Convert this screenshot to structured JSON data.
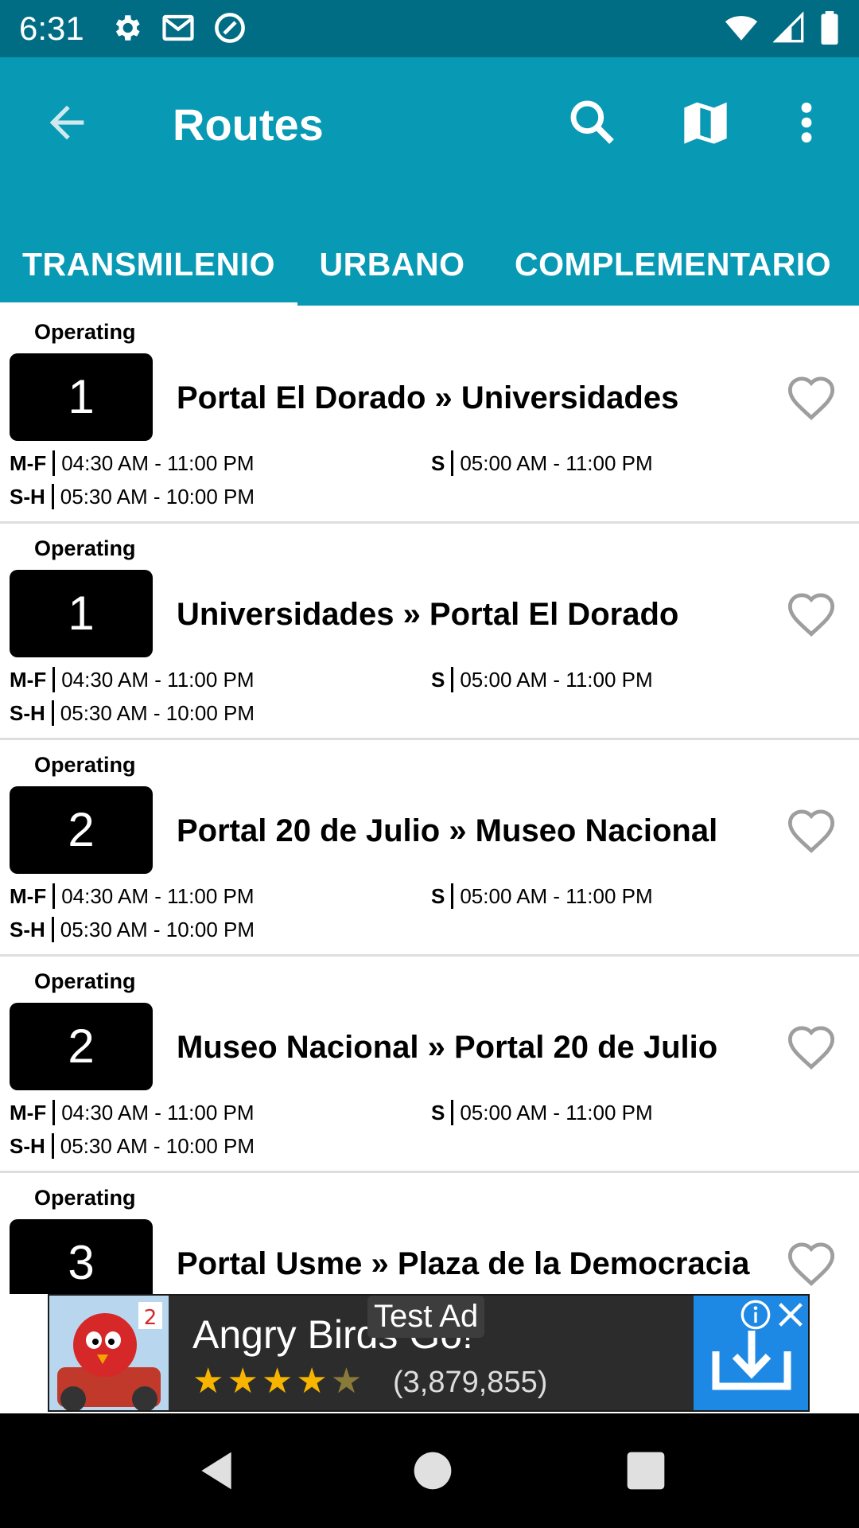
{
  "status_bar": {
    "time": "6:31",
    "icons": [
      "gear-icon",
      "gmail-icon",
      "at-sign-icon",
      "wifi-icon",
      "signal-icon",
      "battery-icon"
    ]
  },
  "app_bar": {
    "title": "Routes",
    "icons": [
      "back-arrow-icon",
      "search-icon",
      "map-icon",
      "more-vert-icon"
    ]
  },
  "tabs": [
    {
      "label": "TRANSMILENIO",
      "selected": true
    },
    {
      "label": "URBANO",
      "selected": false
    },
    {
      "label": "COMPLEMENTARIO",
      "selected": false
    }
  ],
  "colors": {
    "app_bar": "#0899b4",
    "status_bar": "#006d84",
    "tab_indicator": "#ffffff"
  },
  "routes": [
    {
      "status": "Operating",
      "number": "1",
      "name": "Portal El Dorado » Universidades",
      "mf_day": "M-F",
      "mf_hours": "04:30 AM - 11:00 PM",
      "s_day": "S",
      "s_hours": "05:00 AM - 11:00 PM",
      "sh_day": "S-H",
      "sh_hours": "05:30 AM - 10:00 PM"
    },
    {
      "status": "Operating",
      "number": "1",
      "name": "Universidades » Portal El Dorado",
      "mf_day": "M-F",
      "mf_hours": "04:30 AM - 11:00 PM",
      "s_day": "S",
      "s_hours": "05:00 AM - 11:00 PM",
      "sh_day": "S-H",
      "sh_hours": "05:30 AM - 10:00 PM"
    },
    {
      "status": "Operating",
      "number": "2",
      "name": "Portal 20 de Julio » Museo Nacional",
      "mf_day": "M-F",
      "mf_hours": "04:30 AM - 11:00 PM",
      "s_day": "S",
      "s_hours": "05:00 AM - 11:00 PM",
      "sh_day": "S-H",
      "sh_hours": "05:30 AM - 10:00 PM"
    },
    {
      "status": "Operating",
      "number": "2",
      "name": "Museo Nacional » Portal 20 de Julio",
      "mf_day": "M-F",
      "mf_hours": "04:30 AM - 11:00 PM",
      "s_day": "S",
      "s_hours": "05:00 AM - 11:00 PM",
      "sh_day": "S-H",
      "sh_hours": "05:30 AM - 10:00 PM"
    },
    {
      "status": "Operating",
      "number": "3",
      "name": "Portal Usme » Plaza de la Democracia"
    }
  ],
  "ad": {
    "label": "Test Ad",
    "title": "Angry Birds Go!",
    "stars": "★★★★",
    "half_star": "★",
    "rating_count": "(3,879,855)"
  }
}
